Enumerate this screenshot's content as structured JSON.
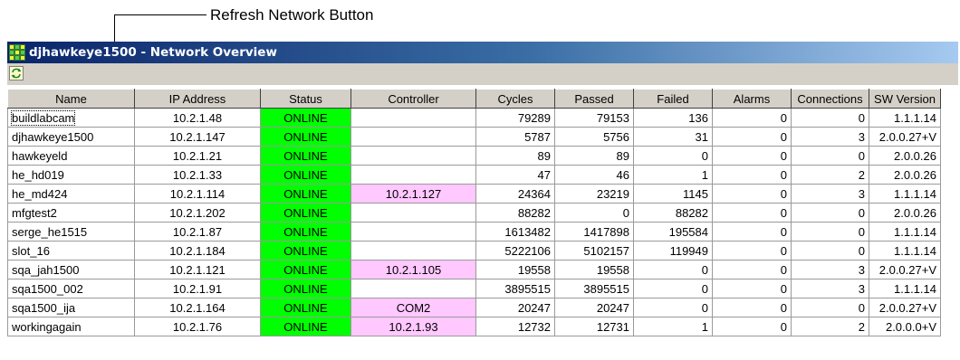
{
  "callout": {
    "label": "Refresh Network Button"
  },
  "window": {
    "title": "djhawkeye1500 - Network Overview"
  },
  "colors": {
    "online": "#00ff00",
    "controller_highlight": "#ffc8ff",
    "title_start": "#0a246a",
    "title_end": "#a6caf0"
  },
  "icons": {
    "app": "network-grid-icon",
    "refresh": "refresh-icon"
  },
  "table": {
    "columns": [
      "Name",
      "IP Address",
      "Status",
      "Controller",
      "Cycles",
      "Passed",
      "Failed",
      "Alarms",
      "Connections",
      "SW Version"
    ],
    "rows": [
      [
        "buildlabcam",
        "10.2.1.48",
        "ONLINE",
        "",
        "79289",
        "79153",
        "136",
        "0",
        "0",
        "1.1.1.14"
      ],
      [
        "djhawkeye1500",
        "10.2.1.147",
        "ONLINE",
        "",
        "5787",
        "5756",
        "31",
        "0",
        "3",
        "2.0.0.27+V"
      ],
      [
        "hawkeyeld",
        "10.2.1.21",
        "ONLINE",
        "",
        "89",
        "89",
        "0",
        "0",
        "0",
        "2.0.0.26"
      ],
      [
        "he_hd019",
        "10.2.1.33",
        "ONLINE",
        "",
        "47",
        "46",
        "1",
        "0",
        "2",
        "2.0.0.26"
      ],
      [
        "he_md424",
        "10.2.1.114",
        "ONLINE",
        "10.2.1.127",
        "24364",
        "23219",
        "1145",
        "0",
        "3",
        "1.1.1.14"
      ],
      [
        "mfgtest2",
        "10.2.1.202",
        "ONLINE",
        "",
        "88282",
        "0",
        "88282",
        "0",
        "0",
        "2.0.0.26"
      ],
      [
        "serge_he1515",
        "10.2.1.87",
        "ONLINE",
        "",
        "1613482",
        "1417898",
        "195584",
        "0",
        "0",
        "1.1.1.14"
      ],
      [
        "slot_16",
        "10.2.1.184",
        "ONLINE",
        "",
        "5222106",
        "5102157",
        "119949",
        "0",
        "0",
        "1.1.1.14"
      ],
      [
        "sqa_jah1500",
        "10.2.1.121",
        "ONLINE",
        "10.2.1.105",
        "19558",
        "19558",
        "0",
        "0",
        "3",
        "2.0.0.27+V"
      ],
      [
        "sqa1500_002",
        "10.2.1.91",
        "ONLINE",
        "",
        "3895515",
        "3895515",
        "0",
        "0",
        "3",
        "1.1.1.14"
      ],
      [
        "sqa1500_ija",
        "10.2.1.164",
        "ONLINE",
        "COM2",
        "20247",
        "20247",
        "0",
        "0",
        "0",
        "2.0.0.27+V"
      ],
      [
        "workingagain",
        "10.2.1.76",
        "ONLINE",
        "10.2.1.93",
        "12732",
        "12731",
        "1",
        "0",
        "2",
        "2.0.0.0+V"
      ]
    ]
  }
}
